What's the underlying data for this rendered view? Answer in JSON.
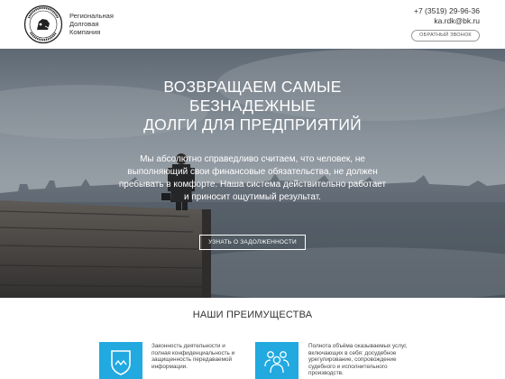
{
  "header": {
    "company_lines": [
      "Региональная",
      "Долговая",
      "Компания"
    ],
    "phone": "+7 (3519) 29-96-36",
    "email": "ka.rdk@bk.ru",
    "callback_label": "ОБРАТНЫЙ ЗВОНОК"
  },
  "hero": {
    "title_lines": [
      "ВОЗВРАЩАЕМ САМЫЕ",
      "БЕЗНАДЕЖНЫЕ",
      "ДОЛГИ ДЛЯ ПРЕДПРИЯТИЙ"
    ],
    "text": "Мы абсолютно справедливо считаем, что человек, не выполняющий свои финансовые обязательства, не должен пребывать в комфорте. Наша система действительно работает и приносит ощутимый результат.",
    "button_label": "УЗНАТЬ О ЗАДОЛЖЕННОСТИ"
  },
  "advantages": {
    "title": "НАШИ ПРЕИМУЩЕСТВА",
    "items": [
      {
        "icon": "shield-icon",
        "text": "Законность деятельности и полная конфиденциальность и защищенность передаваемой информации."
      },
      {
        "icon": "people-icon",
        "text": "Полнота объёма оказываемых услуг, включающих в себя: досудебное урегулирование, сопровождение судебного и исполнительного производств."
      }
    ]
  },
  "colors": {
    "accent": "#21a9e0",
    "hero_overlay": "#5d6772"
  },
  "icons": {
    "logo": "company-seal-logo"
  }
}
